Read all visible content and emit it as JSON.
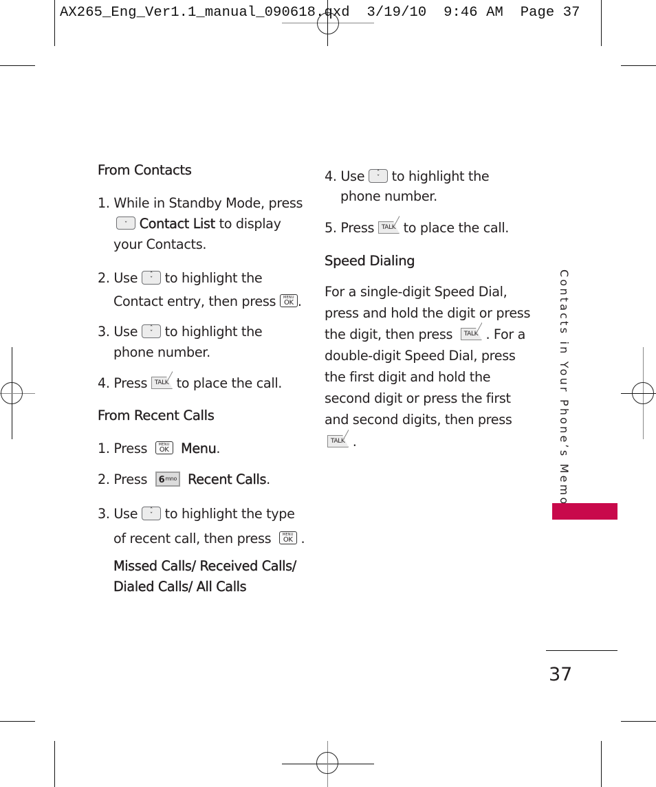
{
  "print_slug": "AX265_Eng_Ver1.1_manual_090618.qxd  3/19/10  9:46 AM  Page 37",
  "colors": {
    "accent": "#c8094b",
    "text": "#231f20"
  },
  "left_column": {
    "from_contacts": {
      "heading": "From Contacts",
      "steps": [
        {
          "num": "1.",
          "lines": [
            "While in Standby Mode, press",
            "Contact List",
            "to display",
            "your Contacts."
          ],
          "icons": [
            "nav-down-key-icon"
          ]
        },
        {
          "num": "2.",
          "text_a": "Use",
          "text_b": "to highlight the",
          "text_c": "Contact entry, then press",
          "text_d": ".",
          "icons": [
            "nav-updown-key-icon",
            "menu-ok-key-icon"
          ]
        },
        {
          "num": "3.",
          "text_a": "Use",
          "text_b": "to highlight the",
          "text_c": "phone number.",
          "icons": [
            "nav-updown-key-icon"
          ]
        },
        {
          "num": "4.",
          "text_a": "Press",
          "text_b": "to place the call.",
          "icons": [
            "talk-key-icon"
          ]
        }
      ]
    },
    "from_recent_calls": {
      "heading": "From Recent Calls",
      "steps": [
        {
          "num": "1.",
          "text_a": "Press",
          "bold": "Menu",
          "text_b": ".",
          "icons": [
            "menu-ok-key-icon"
          ]
        },
        {
          "num": "2.",
          "text_a": "Press",
          "bold": "Recent Calls",
          "text_b": ".",
          "icons": [
            "six-mno-key-icon"
          ]
        },
        {
          "num": "3.",
          "text_a": "Use",
          "text_b": "to highlight the type",
          "text_c": "of recent call, then press",
          "text_d": ".",
          "icons": [
            "nav-updown-key-icon",
            "menu-ok-key-icon"
          ]
        }
      ],
      "options_line1": "Missed Calls/ Received Calls/",
      "options_line2": "Dialed Calls/ All Calls"
    }
  },
  "right_column": {
    "steps": [
      {
        "num": "4.",
        "text_a": "Use",
        "text_b": "to highlight the",
        "text_c": "phone number.",
        "icons": [
          "nav-updown-key-icon"
        ]
      },
      {
        "num": "5.",
        "text_a": "Press",
        "text_b": "to place the call.",
        "icons": [
          "talk-key-icon"
        ]
      }
    ],
    "speed_dialing": {
      "heading": "Speed Dialing",
      "lines": [
        "For a single-digit Speed Dial,",
        "press and hold the digit or press",
        "the digit, then press",
        ". For a",
        "double-digit Speed Dial, press",
        "the first digit and hold the",
        "second digit or press the first",
        "and second digits, then press",
        "."
      ]
    }
  },
  "keys": {
    "talk": "TALK",
    "menu": "MENU",
    "ok": "OK",
    "six": "6",
    "six_letters": "mno",
    "up": "ˆ",
    "down": "ˇ"
  },
  "side_tab": "Contacts in Your Phone’s Memory",
  "page_number": "37"
}
